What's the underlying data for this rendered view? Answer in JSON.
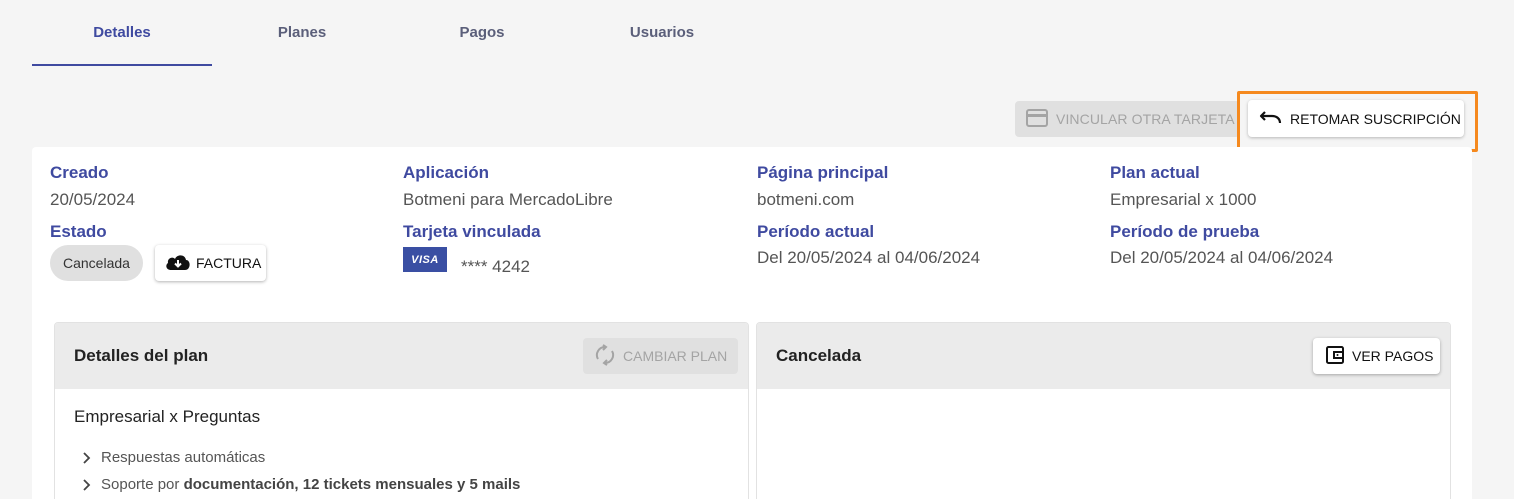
{
  "tabs": [
    {
      "label": "Detalles",
      "active": true
    },
    {
      "label": "Planes",
      "active": false
    },
    {
      "label": "Pagos",
      "active": false
    },
    {
      "label": "Usuarios",
      "active": false
    }
  ],
  "actions": {
    "link_card_label": "VINCULAR OTRA TARJETA",
    "resume_label": "RETOMAR SUSCRIPCIÓN"
  },
  "info": {
    "created_label": "Creado",
    "created_value": "20/05/2024",
    "status_label": "Estado",
    "status_value": "Cancelada",
    "invoice_label": "FACTURA",
    "app_label": "Aplicación",
    "app_value": "Botmeni para MercadoLibre",
    "card_label": "Tarjeta vinculada",
    "card_brand": "VISA",
    "card_number": "**** 4242",
    "homepage_label": "Página principal",
    "homepage_value": "botmeni.com",
    "current_period_label": "Período actual",
    "current_period_value": "Del 20/05/2024 al 04/06/2024",
    "current_plan_label": "Plan actual",
    "current_plan_value": "Empresarial x 1000",
    "trial_period_label": "Período de prueba",
    "trial_period_value": "Del 20/05/2024 al 04/06/2024"
  },
  "plan_panel": {
    "title": "Detalles del plan",
    "change_plan_label": "CAMBIAR PLAN",
    "plan_name": "Empresarial x Preguntas",
    "features": [
      {
        "prefix": "Respuestas automáticas",
        "bold": ""
      },
      {
        "prefix": "Soporte por ",
        "bold": "documentación, 12 tickets mensuales y 5 mails"
      }
    ]
  },
  "status_panel": {
    "title": "Cancelada",
    "view_payments_label": "VER PAGOS"
  },
  "colors": {
    "accent": "#3f4aa0",
    "highlight": "#f5891e",
    "disabled_bg": "#e0e0e0"
  }
}
